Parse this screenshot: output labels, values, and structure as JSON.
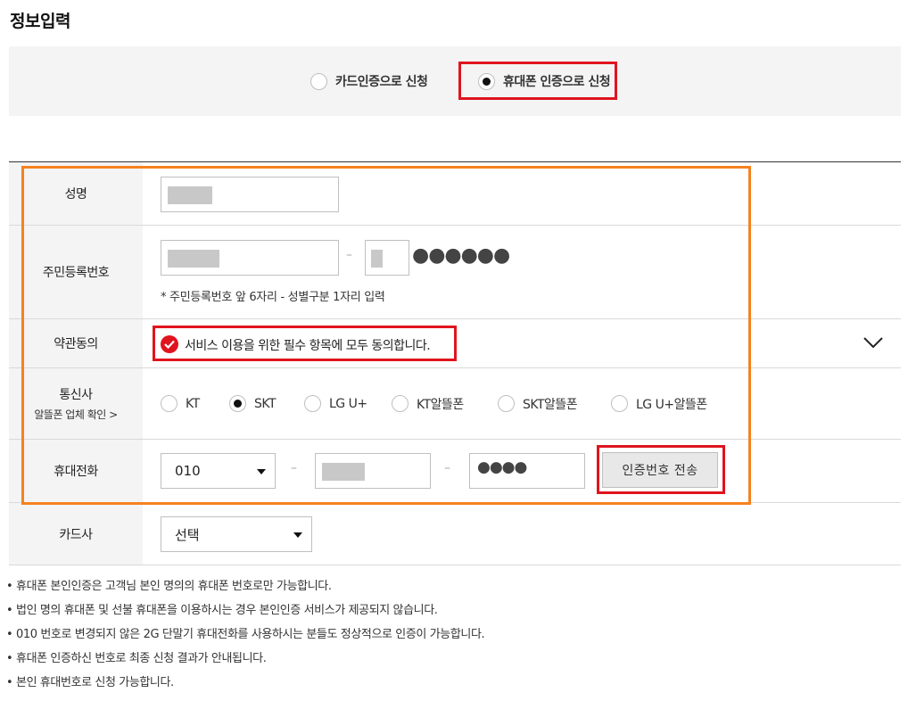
{
  "page_title": "정보입력",
  "auth_method": {
    "options": [
      {
        "label": "카드인증으로 신청",
        "checked": false
      },
      {
        "label": "휴대폰 인증으로 신청",
        "checked": true
      }
    ]
  },
  "form": {
    "name": {
      "label": "성명"
    },
    "rrn": {
      "label": "주민등록번호",
      "separator": "–",
      "masked_digits": "●●●●●●",
      "hint": "* 주민등록번호 앞 6자리 - 성별구분 1자리 입력"
    },
    "terms": {
      "label": "약관동의",
      "agree_text": "서비스 이용을 위한 필수 항목에 모두 동의합니다.",
      "checked": true
    },
    "carrier": {
      "label": "통신사",
      "sub_link": "알뜰폰 업체 확인 >",
      "options": [
        {
          "label": "KT",
          "checked": false
        },
        {
          "label": "SKT",
          "checked": true
        },
        {
          "label": "LG U+",
          "checked": false
        },
        {
          "label": "KT알뜰폰",
          "checked": false
        },
        {
          "label": "SKT알뜰폰",
          "checked": false
        },
        {
          "label": "LG U+알뜰폰",
          "checked": false
        }
      ]
    },
    "phone": {
      "label": "휴대전화",
      "prefix": "010",
      "separator": "–",
      "last_masked": "●●●●",
      "send_button": "인증번호 전송"
    },
    "card_company": {
      "label": "카드사",
      "selected": "선택"
    }
  },
  "notes": [
    "휴대폰 본인인증은 고객님 본인 명의의 휴대폰 번호로만 가능합니다.",
    "법인 명의 휴대폰 및 선불 휴대폰을 이용하시는 경우 본인인증 서비스가 제공되지 않습니다.",
    "010 번호로 변경되지 않은 2G 단말기 휴대전화를 사용하시는 분들도 정상적으로 인증이 가능합니다.",
    "휴대폰 인증하신 번호로 최종 신청 결과가 안내됩니다.",
    "본인 휴대번호로 신청 가능합니다."
  ],
  "colors": {
    "highlight_red": "#e0141e",
    "highlight_orange": "#f5821f",
    "label_bg": "#f4f4f4"
  }
}
